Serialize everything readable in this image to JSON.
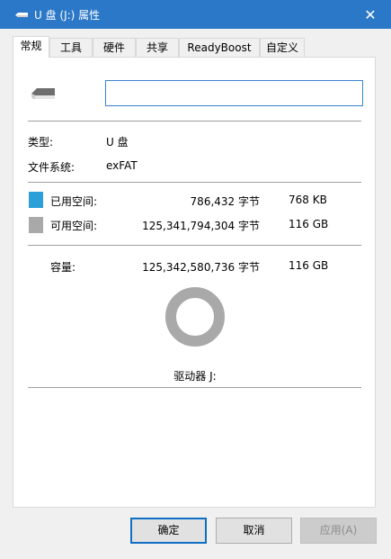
{
  "window": {
    "title": "U 盘 (J:) 属性",
    "close_symbol": "✕"
  },
  "tabs": [
    {
      "label": "常规",
      "active": true
    },
    {
      "label": "工具"
    },
    {
      "label": "硬件"
    },
    {
      "label": "共享"
    },
    {
      "label": "ReadyBoost"
    },
    {
      "label": "自定义"
    }
  ],
  "general": {
    "name_value": "",
    "type_label": "类型:",
    "type_value": "U 盘",
    "fs_label": "文件系统:",
    "fs_value": "exFAT",
    "used": {
      "label": "已用空间:",
      "bytes": "786,432 字节",
      "size": "768 KB",
      "color": "#2a9fd8"
    },
    "free": {
      "label": "可用空间:",
      "bytes": "125,341,794,304 字节",
      "size": "116 GB",
      "color": "#a9a9a9"
    },
    "capacity": {
      "label": "容量:",
      "bytes": "125,342,580,736 字节",
      "size": "116 GB"
    },
    "used_fraction": 6.3e-06,
    "drive_label": "驱动器 J:"
  },
  "buttons": {
    "ok": "确定",
    "cancel": "取消",
    "apply": "应用(A)"
  }
}
